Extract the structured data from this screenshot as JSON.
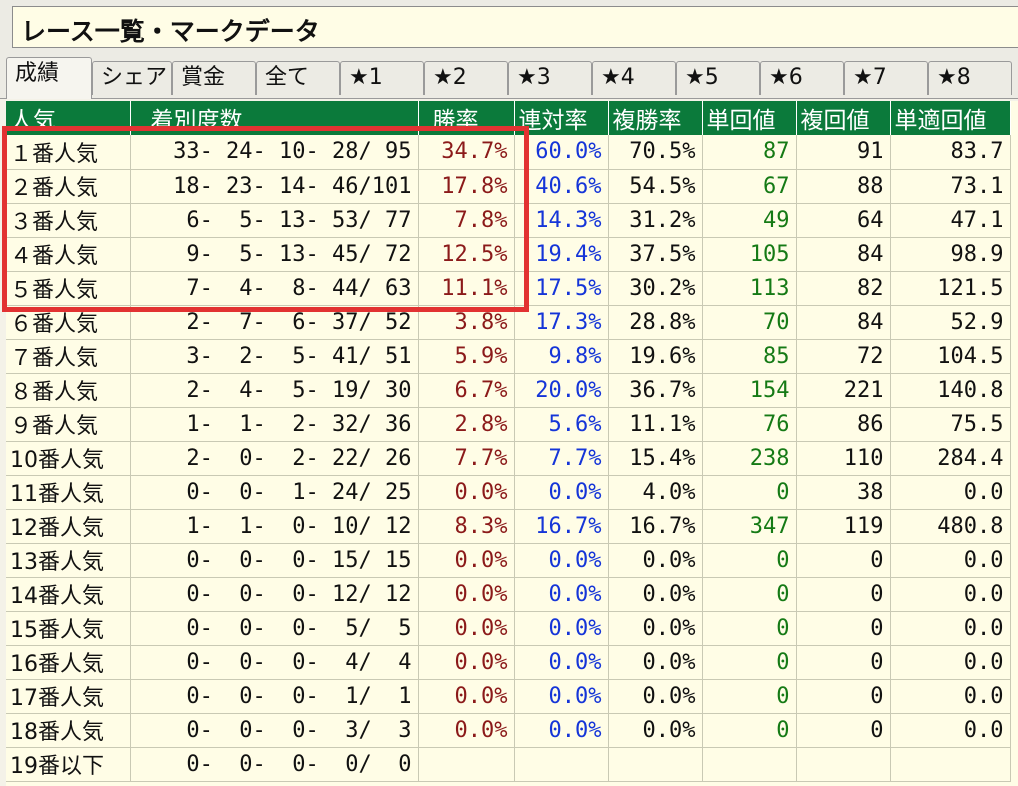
{
  "window": {
    "title": "レース一覧・マークデータ"
  },
  "tabs": [
    {
      "label": "成績",
      "active": true
    },
    {
      "label": "シェア",
      "active": false
    },
    {
      "label": "賞金",
      "active": false
    },
    {
      "label": "全て",
      "active": false
    },
    {
      "label": "★1",
      "active": false
    },
    {
      "label": "★2",
      "active": false
    },
    {
      "label": "★3",
      "active": false
    },
    {
      "label": "★4",
      "active": false
    },
    {
      "label": "★5",
      "active": false
    },
    {
      "label": "★6",
      "active": false
    },
    {
      "label": "★7",
      "active": false
    },
    {
      "label": "★8",
      "active": false
    }
  ],
  "table": {
    "headers": [
      "人気",
      "着別度数",
      "勝率",
      "連対率",
      "複勝率",
      "単回値",
      "複回値",
      "単適回値"
    ],
    "rows": [
      {
        "pop": "１番人気",
        "record": "33- 24- 10- 28/ 95",
        "win": "34.7%",
        "quinella": "60.0%",
        "place": "70.5%",
        "tan": "87",
        "fuku": "91",
        "tekitan": "83.7"
      },
      {
        "pop": "２番人気",
        "record": "18- 23- 14- 46/101",
        "win": "17.8%",
        "quinella": "40.6%",
        "place": "54.5%",
        "tan": "67",
        "fuku": "88",
        "tekitan": "73.1"
      },
      {
        "pop": "３番人気",
        "record": "6-  5- 13- 53/ 77",
        "win": "7.8%",
        "quinella": "14.3%",
        "place": "31.2%",
        "tan": "49",
        "fuku": "64",
        "tekitan": "47.1"
      },
      {
        "pop": "４番人気",
        "record": "9-  5- 13- 45/ 72",
        "win": "12.5%",
        "quinella": "19.4%",
        "place": "37.5%",
        "tan": "105",
        "fuku": "84",
        "tekitan": "98.9"
      },
      {
        "pop": "５番人気",
        "record": "7-  4-  8- 44/ 63",
        "win": "11.1%",
        "quinella": "17.5%",
        "place": "30.2%",
        "tan": "113",
        "fuku": "82",
        "tekitan": "121.5"
      },
      {
        "pop": "６番人気",
        "record": "2-  7-  6- 37/ 52",
        "win": "3.8%",
        "quinella": "17.3%",
        "place": "28.8%",
        "tan": "70",
        "fuku": "84",
        "tekitan": "52.9"
      },
      {
        "pop": "７番人気",
        "record": "3-  2-  5- 41/ 51",
        "win": "5.9%",
        "quinella": "9.8%",
        "place": "19.6%",
        "tan": "85",
        "fuku": "72",
        "tekitan": "104.5"
      },
      {
        "pop": "８番人気",
        "record": "2-  4-  5- 19/ 30",
        "win": "6.7%",
        "quinella": "20.0%",
        "place": "36.7%",
        "tan": "154",
        "fuku": "221",
        "tekitan": "140.8"
      },
      {
        "pop": "９番人気",
        "record": "1-  1-  2- 32/ 36",
        "win": "2.8%",
        "quinella": "5.6%",
        "place": "11.1%",
        "tan": "76",
        "fuku": "86",
        "tekitan": "75.5"
      },
      {
        "pop": "10番人気",
        "record": "2-  0-  2- 22/ 26",
        "win": "7.7%",
        "quinella": "7.7%",
        "place": "15.4%",
        "tan": "238",
        "fuku": "110",
        "tekitan": "284.4"
      },
      {
        "pop": "11番人気",
        "record": "0-  0-  1- 24/ 25",
        "win": "0.0%",
        "quinella": "0.0%",
        "place": "4.0%",
        "tan": "0",
        "fuku": "38",
        "tekitan": "0.0"
      },
      {
        "pop": "12番人気",
        "record": "1-  1-  0- 10/ 12",
        "win": "8.3%",
        "quinella": "16.7%",
        "place": "16.7%",
        "tan": "347",
        "fuku": "119",
        "tekitan": "480.8"
      },
      {
        "pop": "13番人気",
        "record": "0-  0-  0- 15/ 15",
        "win": "0.0%",
        "quinella": "0.0%",
        "place": "0.0%",
        "tan": "0",
        "fuku": "0",
        "tekitan": "0.0"
      },
      {
        "pop": "14番人気",
        "record": "0-  0-  0- 12/ 12",
        "win": "0.0%",
        "quinella": "0.0%",
        "place": "0.0%",
        "tan": "0",
        "fuku": "0",
        "tekitan": "0.0"
      },
      {
        "pop": "15番人気",
        "record": "0-  0-  0-  5/  5",
        "win": "0.0%",
        "quinella": "0.0%",
        "place": "0.0%",
        "tan": "0",
        "fuku": "0",
        "tekitan": "0.0"
      },
      {
        "pop": "16番人気",
        "record": "0-  0-  0-  4/  4",
        "win": "0.0%",
        "quinella": "0.0%",
        "place": "0.0%",
        "tan": "0",
        "fuku": "0",
        "tekitan": "0.0"
      },
      {
        "pop": "17番人気",
        "record": "0-  0-  0-  1/  1",
        "win": "0.0%",
        "quinella": "0.0%",
        "place": "0.0%",
        "tan": "0",
        "fuku": "0",
        "tekitan": "0.0"
      },
      {
        "pop": "18番人気",
        "record": "0-  0-  0-  3/  3",
        "win": "0.0%",
        "quinella": "0.0%",
        "place": "0.0%",
        "tan": "0",
        "fuku": "0",
        "tekitan": "0.0"
      },
      {
        "pop": "19番以下",
        "record": "0-  0-  0-  0/  0",
        "win": "",
        "quinella": "",
        "place": "",
        "tan": "",
        "fuku": "",
        "tekitan": ""
      }
    ]
  },
  "colors": {
    "header_bg": "#0b7a3b",
    "grid_bg": "#fffde6",
    "win_rate": "#8b1a1a",
    "quinella_rate": "#1535d8",
    "tan_return": "#157a15",
    "highlight_box": "#e23232"
  }
}
